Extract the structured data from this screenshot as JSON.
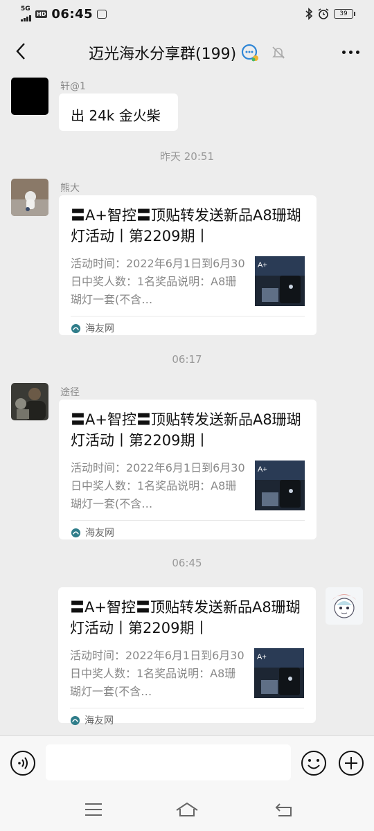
{
  "status": {
    "network": "5G",
    "hd": "HD",
    "time": "06:45",
    "battery": "39"
  },
  "header": {
    "title": "迈光海水分享群(199)"
  },
  "messages": {
    "m1": {
      "sender": "轩@1",
      "text": "出 24k 金火柴"
    },
    "t1": "昨天 20:51",
    "m2": {
      "sender": "熊大",
      "title": "〓A+智控〓顶贴转发送新品A8珊瑚灯活动丨第2209期丨",
      "desc": "活动时间：2022年6月1日到6月30日中奖人数：1名奖品说明：A8珊瑚灯一套(不含…",
      "source": "海友网"
    },
    "t2": "06:17",
    "m3": {
      "sender": "途径",
      "title": "〓A+智控〓顶贴转发送新品A8珊瑚灯活动丨第2209期丨",
      "desc": "活动时间：2022年6月1日到6月30日中奖人数：1名奖品说明：A8珊瑚灯一套(不含…",
      "source": "海友网"
    },
    "t3": "06:45",
    "m4": {
      "title": "〓A+智控〓顶贴转发送新品A8珊瑚灯活动丨第2209期丨",
      "desc": "活动时间：2022年6月1日到6月30日中奖人数：1名奖品说明：A8珊瑚灯一套(不含…",
      "source": "海友网"
    }
  },
  "input": {
    "value": ""
  },
  "colors": {
    "background": "#ededed",
    "bubble": "#ffffff",
    "muted_text": "#888888",
    "source_icon": "#2f7d8a"
  },
  "icons": [
    "back-arrow-icon",
    "group-chat-icon",
    "mute-bell-icon",
    "more-dots-icon",
    "voice-icon",
    "emoji-icon",
    "plus-icon",
    "menu-icon",
    "home-icon",
    "return-icon",
    "site-logo-icon"
  ]
}
